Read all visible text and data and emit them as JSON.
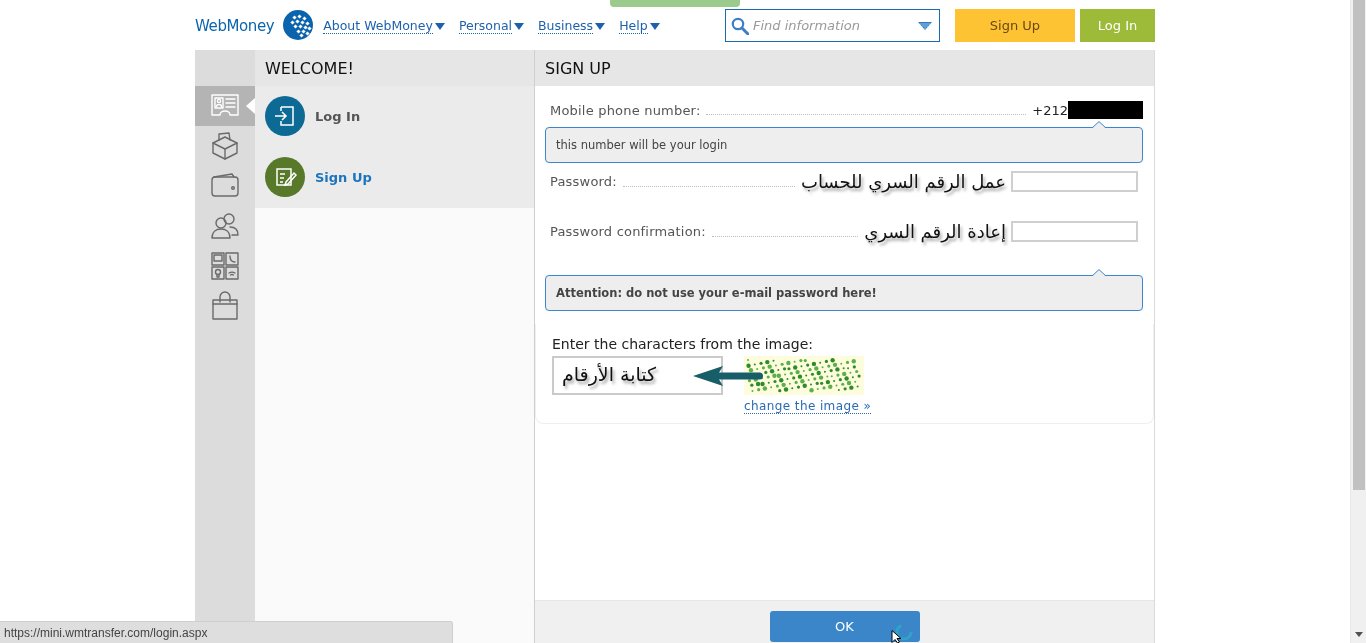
{
  "header": {
    "logo": "WebMoney",
    "nav": [
      {
        "label": "About WebMoney"
      },
      {
        "label": "Personal"
      },
      {
        "label": "Business"
      },
      {
        "label": "Help"
      }
    ],
    "search": {
      "placeholder": "Find information"
    },
    "buttons": [
      {
        "label": "Sign Up",
        "kind": "signup"
      },
      {
        "label": "Log In",
        "kind": "login"
      }
    ]
  },
  "sidebar": {
    "items": [
      {
        "kind": "card",
        "selected": true
      },
      {
        "kind": "box",
        "selected": false
      },
      {
        "kind": "wallet",
        "selected": false
      },
      {
        "kind": "people",
        "selected": false
      },
      {
        "kind": "devices",
        "selected": false
      },
      {
        "kind": "bag",
        "selected": false
      }
    ]
  },
  "welcome_panel": {
    "title": "WELCOME!",
    "items": [
      {
        "label": "Log In",
        "kind": "login",
        "selected": false
      },
      {
        "label": "Sign Up",
        "kind": "signup",
        "selected": true
      }
    ]
  },
  "signup_form": {
    "title": "SIGN UP",
    "rows": [
      {
        "kind": "phone",
        "label": "Mobile phone number:",
        "value": "+212",
        "redacted": true
      },
      {
        "kind": "note",
        "text": "this number will be your login"
      },
      {
        "kind": "password",
        "label": "Password:",
        "annotation": "عمل الرقم السري للحساب"
      },
      {
        "kind": "password",
        "label": "Password confirmation:",
        "annotation": "إعادة الرقم السري"
      },
      {
        "kind": "warning",
        "text": "Attention: do not use your e-mail password here!"
      }
    ],
    "captcha": {
      "label": "Enter the characters from the image:",
      "annotation": "كتابة الأرقام",
      "link": "change the image »"
    },
    "submit": "OK"
  },
  "status_bar": {
    "url": "https://mini.wmtransfer.com/login.aspx"
  }
}
